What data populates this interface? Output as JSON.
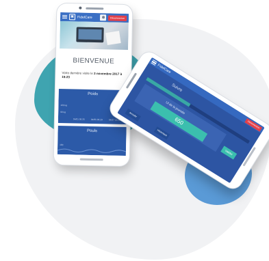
{
  "app": {
    "logo_text": "FidelCare",
    "logout_label": "Déconnexion"
  },
  "phone1": {
    "welcome_title": "BIENVENUE",
    "last_visit_prefix": "Votre dernière visite le",
    "last_visit_date": "3 novembre 2017 à 15:23",
    "chart1_title": "Poids",
    "chart1_ticks": [
      "100 kg",
      "90 kg",
      "04/01 00:25",
      "04/05 00:29",
      "04/07 13:25"
    ],
    "chart2_title": "Pouls",
    "chart2_tick": "100"
  },
  "phone2": {
    "title": "Suivre",
    "card_label": "Ul de la journée",
    "value": "650",
    "save_label": "Valider",
    "bottom_left": "Annuler",
    "bottom_right": "Historique"
  },
  "colors": {
    "primary": "#2d55a3",
    "accent_teal": "#3bbfae",
    "logout_red": "#e2404a",
    "blob_teal": "#3fa4b0",
    "blob_blue": "#5a9ad6"
  }
}
